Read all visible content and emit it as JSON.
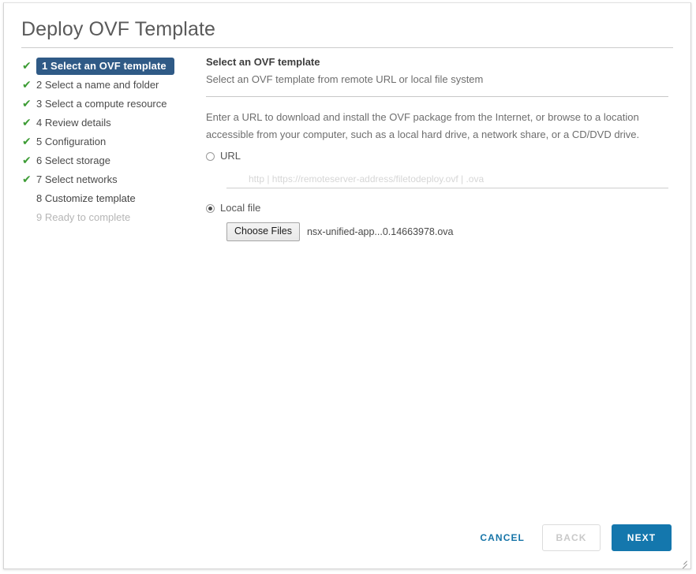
{
  "dialog": {
    "title": "Deploy OVF Template"
  },
  "steps": [
    {
      "number": "1",
      "label": "1 Select an OVF template",
      "state": "current",
      "check": "✔"
    },
    {
      "number": "2",
      "label": "2 Select a name and folder",
      "state": "done",
      "check": "✔"
    },
    {
      "number": "3",
      "label": "3 Select a compute resource",
      "state": "done",
      "check": "✔"
    },
    {
      "number": "4",
      "label": "4 Review details",
      "state": "done",
      "check": "✔"
    },
    {
      "number": "5",
      "label": "5 Configuration",
      "state": "done",
      "check": "✔"
    },
    {
      "number": "6",
      "label": "6 Select storage",
      "state": "done",
      "check": "✔"
    },
    {
      "number": "7",
      "label": "7 Select networks",
      "state": "done",
      "check": "✔"
    },
    {
      "number": "8",
      "label": "8 Customize template",
      "state": "pending",
      "check": ""
    },
    {
      "number": "9",
      "label": "9 Ready to complete",
      "state": "disabled",
      "check": ""
    }
  ],
  "panel": {
    "heading": "Select an OVF template",
    "subheading": "Select an OVF template from remote URL or local file system",
    "description": "Enter a URL to download and install the OVF package from the Internet, or browse to a location accessible from your computer, such as a local hard drive, a network share, or a CD/DVD drive.",
    "url_option": {
      "label": "URL",
      "selected": false,
      "input_value": "",
      "input_placeholder": "http | https://remoteserver-address/filetodeploy.ovf | .ova"
    },
    "local_file_option": {
      "label": "Local file",
      "selected": true,
      "choose_button_label": "Choose Files",
      "file_name": "nsx-unified-app...0.14663978.ova"
    }
  },
  "footer": {
    "cancel_label": "CANCEL",
    "back_label": "BACK",
    "next_label": "NEXT"
  },
  "colors": {
    "accent_blue": "#1477ad",
    "step_current_bg": "#2f5a86",
    "check_green": "#3d9c35",
    "link_blue": "#1775a8"
  }
}
